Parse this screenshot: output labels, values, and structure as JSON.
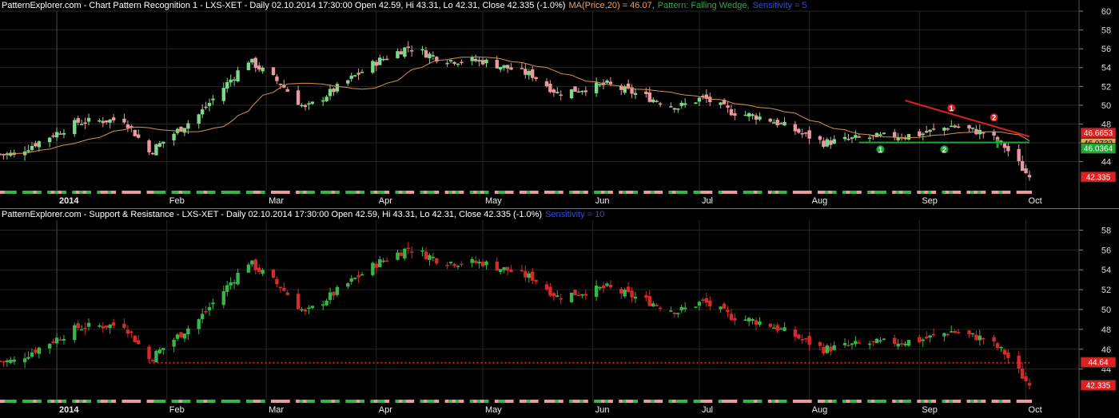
{
  "colors": {
    "background": "#000000",
    "grid": "#262626",
    "bull": "#37b44a",
    "bull_light": "#7fd88a",
    "bear": "#d42a2a",
    "bear_light": "#e89aa0",
    "ma": "#d9914a",
    "resistance_line": "#e02020",
    "support_line": "#1faa2f",
    "sr_level": "#e02020"
  },
  "panel1": {
    "header_segments": [
      {
        "text": "PatternExplorer.com - Chart Pattern Recognition 1  - LXS-XET - Daily 02.10.2014 17:30:00 Open 42.59, Hi 43.31, Lo 42.31, Close 42.335 (-1.0%)",
        "style": "plain"
      },
      {
        "text": "MA(Price,20) = 46.07,",
        "style": "ma"
      },
      {
        "text": "Pattern: Falling Wedge,",
        "style": "pat"
      },
      {
        "text": "Sensitivity = 5",
        "style": "sens"
      }
    ],
    "price_tags": [
      {
        "label": "46.6653",
        "value": 46.6653,
        "color": "#e02020",
        "text": "#ffffff"
      },
      {
        "label": "46.0732",
        "value": 46.0732,
        "color": "#e6a15a",
        "text": "#000000"
      },
      {
        "label": "46.0364",
        "value": 46.0364,
        "color": "#1faa2f",
        "text": "#ffffff"
      },
      {
        "label": "42.335",
        "value": 42.335,
        "color": "#e02020",
        "text": "#ffffff"
      }
    ],
    "pattern_markers": [
      {
        "label": "1",
        "color": "#1faa2f"
      },
      {
        "label": "2",
        "color": "#1faa2f"
      },
      {
        "label": "1",
        "color": "#e02020"
      },
      {
        "label": "2",
        "color": "#e02020"
      }
    ],
    "arrow_marker": "up-arrow-icon"
  },
  "panel2": {
    "header_segments": [
      {
        "text": "PatternExplorer.com - Support & Resistance - LXS-XET - Daily 02.10.2014 17:30:00 Open 42.59, Hi 43.31, Lo 42.31, Close 42.335 (-1.0%)",
        "style": "plain"
      },
      {
        "text": "Sensitivity = 10",
        "style": "sens"
      }
    ],
    "price_tags": [
      {
        "label": "44.64",
        "value": 44.64,
        "color": "#e02020",
        "text": "#ffffff"
      },
      {
        "label": "42.335",
        "value": 42.335,
        "color": "#e02020",
        "text": "#ffffff"
      }
    ]
  },
  "chart_data": [
    {
      "type": "candlestick",
      "title": "Chart Pattern Recognition 1 - LXS-XET - Daily",
      "pattern": "Falling Wedge",
      "ma_label": "MA(Price,20)",
      "ylim": [
        41,
        60
      ],
      "y_ticks": [
        44,
        46,
        48,
        50,
        52,
        54,
        56,
        58,
        60
      ],
      "x_ticks": [
        "2014",
        "Feb",
        "Mar",
        "Apr",
        "May",
        "Jun",
        "Jul",
        "Aug",
        "Sep",
        "Oct"
      ],
      "close_key_points": [
        {
          "date": "2013-12-20",
          "close": 44.8
        },
        {
          "date": "2014-01-07",
          "close": 48.2
        },
        {
          "date": "2014-01-20",
          "close": 48.5
        },
        {
          "date": "2014-01-27",
          "close": 45.0
        },
        {
          "date": "2014-02-10",
          "close": 49.0
        },
        {
          "date": "2014-02-24",
          "close": 54.8
        },
        {
          "date": "2014-03-05",
          "close": 52.3
        },
        {
          "date": "2014-03-12",
          "close": 49.6
        },
        {
          "date": "2014-04-01",
          "close": 54.6
        },
        {
          "date": "2014-04-10",
          "close": 56.2
        },
        {
          "date": "2014-04-20",
          "close": 54.8
        },
        {
          "date": "2014-05-01",
          "close": 54.7
        },
        {
          "date": "2014-05-15",
          "close": 53.2
        },
        {
          "date": "2014-05-22",
          "close": 51.3
        },
        {
          "date": "2014-06-05",
          "close": 52.2
        },
        {
          "date": "2014-06-25",
          "close": 49.8
        },
        {
          "date": "2014-07-02",
          "close": 50.8
        },
        {
          "date": "2014-07-10",
          "close": 49.3
        },
        {
          "date": "2014-07-20",
          "close": 48.6
        },
        {
          "date": "2014-08-05",
          "close": 46.0
        },
        {
          "date": "2014-08-15",
          "close": 46.5
        },
        {
          "date": "2014-09-01",
          "close": 46.9
        },
        {
          "date": "2014-09-10",
          "close": 47.8
        },
        {
          "date": "2014-09-20",
          "close": 47.0
        },
        {
          "date": "2014-09-25",
          "close": 45.6
        },
        {
          "date": "2014-10-02",
          "close": 42.335
        }
      ],
      "last_bar": {
        "date": "2014-10-02",
        "open": 42.59,
        "high": 43.31,
        "low": 42.31,
        "close": 42.335
      },
      "ma_last": 46.07,
      "resistance_line": {
        "start": {
          "date": "2014-08-28",
          "value": 50.5
        },
        "end": {
          "date": "2014-10-02",
          "value": 46.6653
        }
      },
      "support_line": {
        "start": {
          "date": "2014-08-15",
          "value": 46.0364
        },
        "end": {
          "date": "2014-10-02",
          "value": 46.0364
        }
      }
    },
    {
      "type": "candlestick",
      "title": "Support & Resistance - LXS-XET - Daily",
      "ylim": [
        41,
        59
      ],
      "y_ticks": [
        44,
        46,
        48,
        50,
        52,
        54,
        56,
        58
      ],
      "x_ticks": [
        "2014",
        "Feb",
        "Mar",
        "Apr",
        "May",
        "Jun",
        "Jul",
        "Aug",
        "Sep",
        "Oct"
      ],
      "sr_level": 44.64,
      "last_close": 42.335
    }
  ]
}
